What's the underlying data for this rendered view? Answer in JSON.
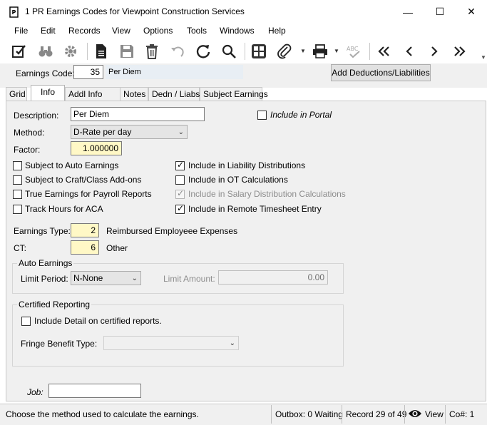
{
  "window": {
    "title": "1 PR Earnings Codes for Viewpoint Construction Services",
    "minimize": "—",
    "maximize": "☐",
    "close": "✕"
  },
  "menu": [
    "File",
    "Edit",
    "Records",
    "View",
    "Options",
    "Tools",
    "Windows",
    "Help"
  ],
  "toolbar": {
    "icons": [
      "edit-icon",
      "binoculars-icon",
      "gear-icon",
      "document-icon",
      "save-icon",
      "delete-icon",
      "undo-icon",
      "refresh-icon",
      "search-icon",
      "calculator-icon",
      "attachment-icon",
      "print-icon",
      "spellcheck-icon",
      "first-record-icon",
      "previous-record-icon",
      "next-record-icon",
      "last-record-icon"
    ]
  },
  "header": {
    "earnings_code_label": "Earnings Code:",
    "earnings_code_value": "35",
    "earnings_code_desc": "Per Diem",
    "add_deductions_button": "Add Deductions/Liabilities"
  },
  "tabs": [
    "Grid",
    "Info",
    "Addl Info",
    "Notes",
    "Dedn / Liabs",
    "Subject Earnings"
  ],
  "active_tab": "Info",
  "form": {
    "description_label": "Description:",
    "description_value": "Per Diem",
    "include_in_portal_label": "Include in Portal",
    "method_label": "Method:",
    "method_value": "D-Rate per day",
    "factor_label": "Factor:",
    "factor_value": "1.000000",
    "checkboxes_left": [
      {
        "label": "Subject to Auto Earnings",
        "checked": false
      },
      {
        "label": "Subject to Craft/Class Add-ons",
        "checked": false
      },
      {
        "label": "True Earnings for Payroll Reports",
        "checked": false
      },
      {
        "label": "Track Hours for ACA",
        "checked": false
      }
    ],
    "checkboxes_right": [
      {
        "label": "Include in Liability Distributions",
        "checked": true,
        "disabled": false
      },
      {
        "label": "Include in OT Calculations",
        "checked": false,
        "disabled": false
      },
      {
        "label": "Include in Salary Distribution Calculations",
        "checked": true,
        "disabled": true
      },
      {
        "label": "Include in Remote Timesheet Entry",
        "checked": true,
        "disabled": false
      }
    ],
    "earnings_type_label": "Earnings Type:",
    "earnings_type_value": "2",
    "earnings_type_desc": "Reimbursed Employeee Expenses",
    "ct_label": "CT:",
    "ct_value": "6",
    "ct_desc": "Other",
    "auto_earnings_title": "Auto Earnings",
    "limit_period_label": "Limit Period:",
    "limit_period_value": "N-None",
    "limit_amount_label": "Limit Amount:",
    "limit_amount_value": "0.00",
    "certified_title": "Certified Reporting",
    "include_detail_label": "Include Detail on certified reports.",
    "fringe_benefit_label": "Fringe Benefit Type:",
    "fringe_benefit_value": "",
    "job_label": "Job:",
    "job_value": ""
  },
  "status": {
    "message": "Choose the method used to calculate the earnings.",
    "outbox": "Outbox: 0 Waiting",
    "record": "Record 29 of 49",
    "view": "View",
    "company": "Co#: 1"
  }
}
